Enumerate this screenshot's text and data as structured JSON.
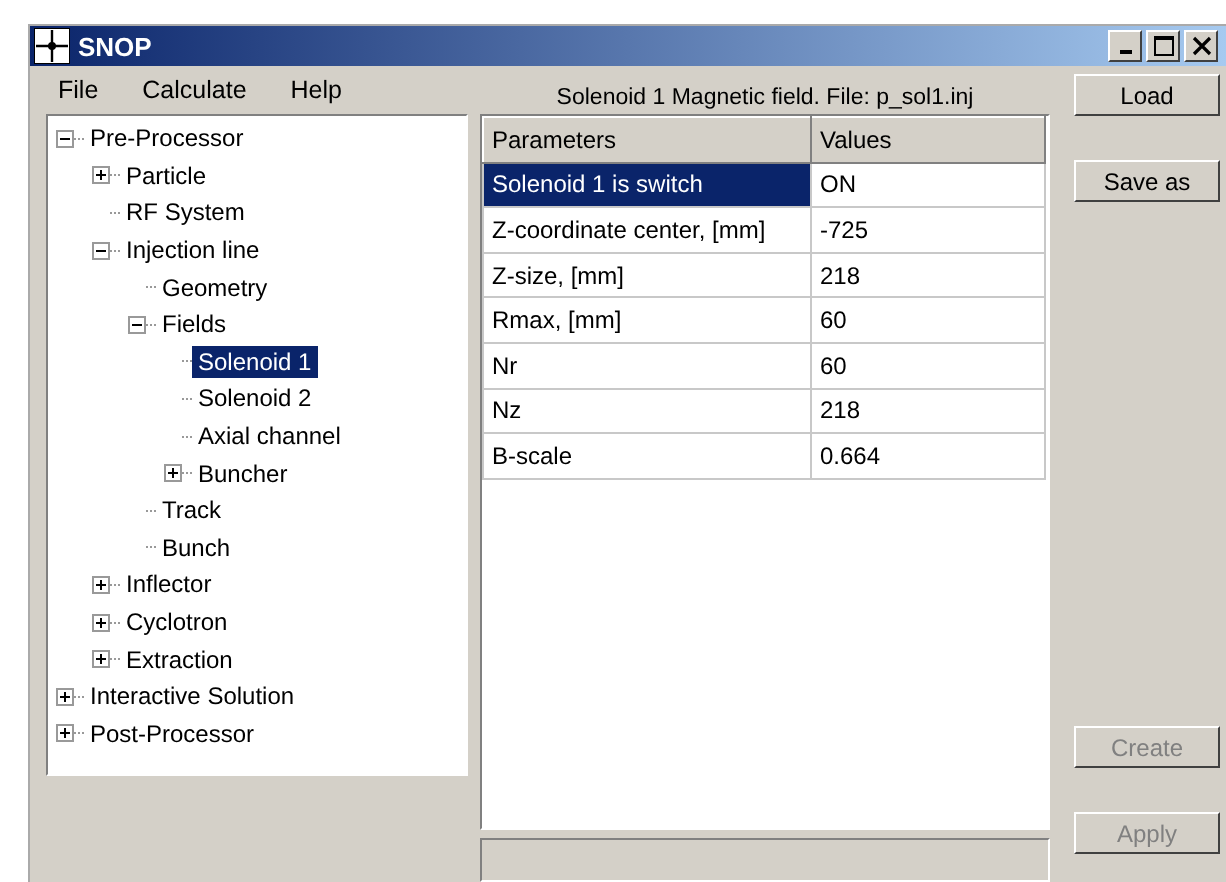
{
  "window": {
    "title": "SNOP"
  },
  "menu": [
    "File",
    "Calculate",
    "Help"
  ],
  "panel_title": "Solenoid 1 Magnetic field. File: p_sol1.inj",
  "tree": [
    {
      "label": "Pre-Processor",
      "selected": false,
      "expanded": true,
      "children": [
        {
          "label": "Particle",
          "selected": false,
          "expanded": false
        },
        {
          "label": "RF System",
          "selected": false
        },
        {
          "label": "Injection line",
          "selected": false,
          "expanded": true,
          "children": [
            {
              "label": "Geometry",
              "selected": false
            },
            {
              "label": "Fields",
              "selected": false,
              "expanded": true,
              "children": [
                {
                  "label": "Solenoid 1",
                  "selected": true
                },
                {
                  "label": "Solenoid 2",
                  "selected": false
                },
                {
                  "label": "Axial channel",
                  "selected": false
                },
                {
                  "label": "Buncher",
                  "selected": false,
                  "expanded": false
                }
              ]
            },
            {
              "label": "Track",
              "selected": false
            },
            {
              "label": "Bunch",
              "selected": false
            }
          ]
        },
        {
          "label": "Inflector",
          "selected": false,
          "expanded": false
        },
        {
          "label": "Cyclotron",
          "selected": false,
          "expanded": false
        },
        {
          "label": "Extraction",
          "selected": false,
          "expanded": false
        }
      ]
    },
    {
      "label": "Interactive Solution",
      "selected": false,
      "expanded": false
    },
    {
      "label": "Post-Processor",
      "selected": false,
      "expanded": false
    }
  ],
  "table": {
    "columns": [
      "Parameters",
      "Values"
    ],
    "rows": [
      {
        "parameter": "Solenoid 1 is switch",
        "value": "ON",
        "selected": true
      },
      {
        "parameter": "Z-coordinate center, [mm]",
        "value": "-725",
        "selected": false
      },
      {
        "parameter": "Z-size, [mm]",
        "value": "218",
        "selected": false
      },
      {
        "parameter": "Rmax, [mm]",
        "value": "60",
        "selected": false
      },
      {
        "parameter": "Nr",
        "value": "60",
        "selected": false
      },
      {
        "parameter": "Nz",
        "value": "218",
        "selected": false
      },
      {
        "parameter": "B-scale",
        "value": "0.664",
        "selected": false
      }
    ]
  },
  "top_buttons": [
    {
      "label": "Load",
      "disabled": false
    },
    {
      "label": "Save as",
      "disabled": false
    }
  ],
  "bottom_buttons": [
    {
      "label": "Create",
      "disabled": true
    },
    {
      "label": "Apply",
      "disabled": true
    }
  ]
}
